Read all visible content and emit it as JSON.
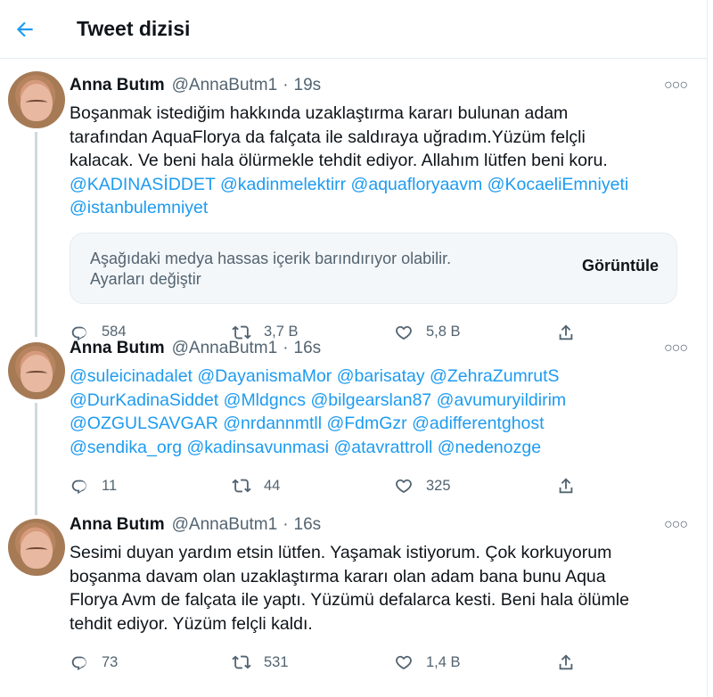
{
  "header": {
    "title": "Tweet dizisi"
  },
  "sensitive": {
    "message": "Aşağıdaki medya hassas içerik barındırıyor olabilir.",
    "settings_link": "Ayarları değiştir",
    "view_button": "Görüntüle"
  },
  "tweets": [
    {
      "name": "Anna Butım",
      "handle": "@AnnaButm1",
      "time": "19s",
      "lines": [
        "Boşanmak istediğim hakkında uzaklaştırma kararı bulunan adam",
        "tarafından AquaFlorya da falçata ile saldıraya uğradım.Yüzüm felçli",
        "kalacak. Ve beni hala ölürmekle tehdit ediyor. Allahım lütfen beni koru.",
        "@KADINASİDDET @kadinmelektirr @aquafloryaavm @KocaeliEmniyeti",
        "@istanbulemniyet"
      ],
      "replies": "584",
      "retweets": "3,7 B",
      "likes": "5,8 B"
    },
    {
      "name": "Anna Butım",
      "handle": "@AnnaButm1",
      "time": "16s",
      "lines": [
        "@suleicinadalet @DayanismaMor @barisatay @ZehraZumrutS",
        "@DurKadinaSiddet @Mldgncs @bilgearslan87 @avumuryildirim",
        "@OZGULSAVGAR @nrdannmtll @FdmGzr @adifferentghost",
        "@sendika_org @kadinsavunmasi @atavrattroll @nedenozge"
      ],
      "replies": "11",
      "retweets": "44",
      "likes": "325"
    },
    {
      "name": "Anna Butım",
      "handle": "@AnnaButm1",
      "time": "16s",
      "lines": [
        "Sesimi duyan yardım etsin lütfen. Yaşamak istiyorum. Çok korkuyorum",
        "boşanma davam olan uzaklaştırma kararı olan adam bana bunu Aqua",
        "Florya Avm de falçata ile yaptı. Yüzümü defalarca kesti. Beni hala ölümle",
        "tehdit ediyor. Yüzüm felçli kaldı."
      ],
      "replies": "73",
      "retweets": "531",
      "likes": "1,4 B"
    }
  ]
}
